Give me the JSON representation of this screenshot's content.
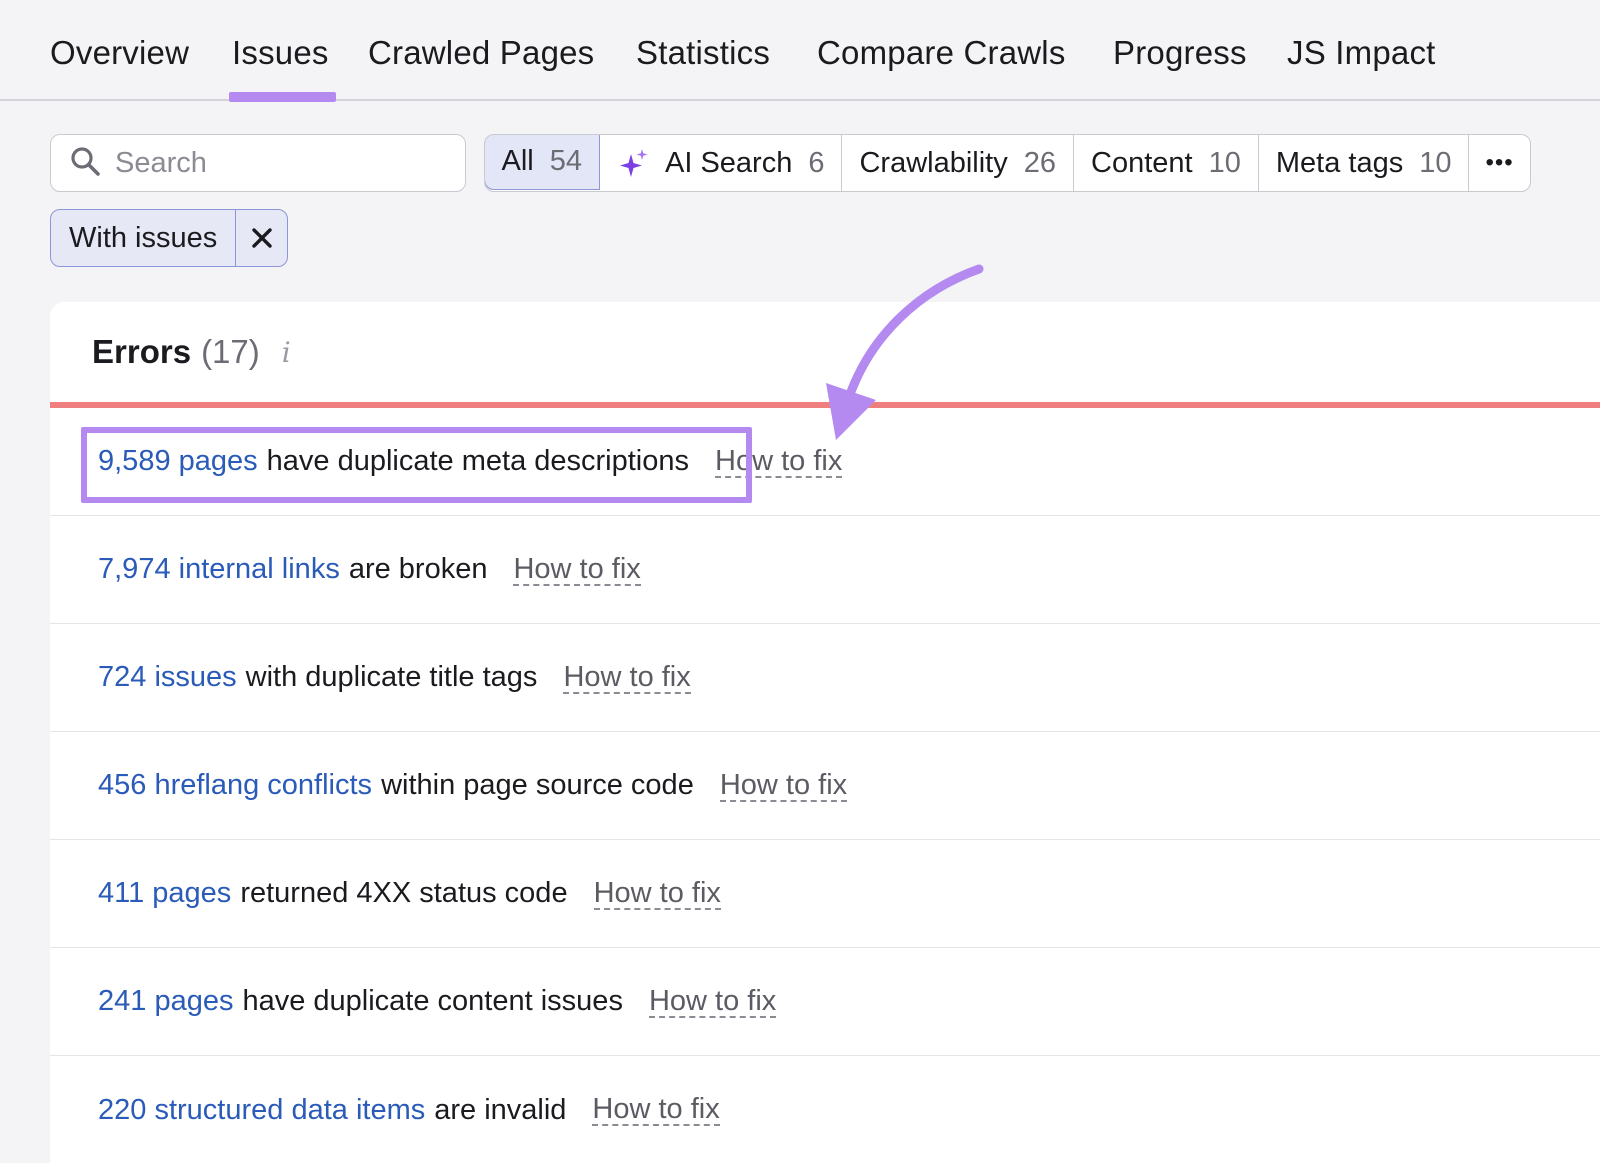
{
  "tabs": [
    {
      "label": "Overview"
    },
    {
      "label": "Issues"
    },
    {
      "label": "Crawled Pages"
    },
    {
      "label": "Statistics"
    },
    {
      "label": "Compare Crawls"
    },
    {
      "label": "Progress"
    },
    {
      "label": "JS Impact"
    }
  ],
  "search": {
    "placeholder": "Search"
  },
  "filters": [
    {
      "label": "All",
      "count": "54"
    },
    {
      "label": "AI Search",
      "count": "6"
    },
    {
      "label": "Crawlability",
      "count": "26"
    },
    {
      "label": "Content",
      "count": "10"
    },
    {
      "label": "Meta tags",
      "count": "10"
    },
    {
      "label": "•••"
    }
  ],
  "chip": {
    "label": "With issues"
  },
  "errors": {
    "title": "Errors",
    "count": "(17)",
    "info": "i",
    "rows": [
      {
        "link": "9,589 pages",
        "text": "have duplicate meta descriptions",
        "fix": "How to fix"
      },
      {
        "link": "7,974 internal links",
        "text": "are broken",
        "fix": "How to fix"
      },
      {
        "link": "724 issues",
        "text": "with duplicate title tags",
        "fix": "How to fix"
      },
      {
        "link": "456 hreflang conflicts",
        "text": "within page source code",
        "fix": "How to fix"
      },
      {
        "link": "411 pages",
        "text": "returned 4XX status code",
        "fix": "How to fix"
      },
      {
        "link": "241 pages",
        "text": "have duplicate content issues",
        "fix": "How to fix"
      },
      {
        "link": "220 structured data items",
        "text": "are invalid",
        "fix": "How to fix"
      }
    ]
  },
  "colors": {
    "accent": "#b48af0",
    "link": "#2a5bb8",
    "error": "#ef7f7f"
  }
}
